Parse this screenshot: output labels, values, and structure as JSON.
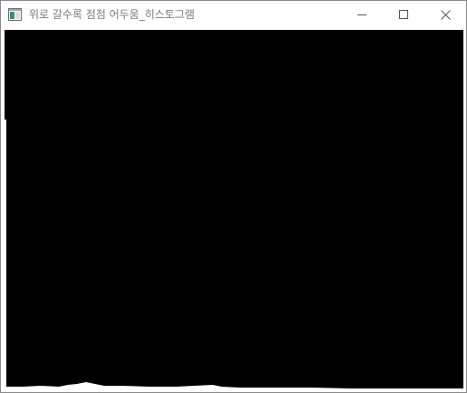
{
  "window": {
    "title": "위로 갈수록 점점 어두움_히스토그램",
    "icon": "opencv-window-icon"
  },
  "controls": {
    "minimize_icon": "minimize-icon",
    "maximize_icon": "maximize-icon",
    "close_icon": "close-icon"
  },
  "canvas": {
    "background": "#000000",
    "histogram_color": "#ffffff"
  }
}
